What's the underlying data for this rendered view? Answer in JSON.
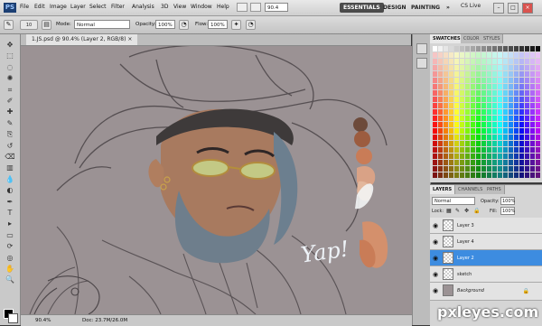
{
  "app": {
    "logo": "PS",
    "menu": [
      "File",
      "Edit",
      "Image",
      "Layer",
      "Select",
      "Filter",
      "Analysis",
      "3D",
      "View",
      "Window",
      "Help"
    ],
    "zoom_field": "90.4",
    "workspaces": [
      "ESSENTIALS",
      "DESIGN",
      "PAINTING"
    ],
    "workspace_more": "»",
    "cs_live": "CS Live",
    "window_buttons": [
      "–",
      "□",
      "×"
    ]
  },
  "options": {
    "mode_label": "Mode:",
    "mode_value": "Normal",
    "opacity_label": "Opacity:",
    "opacity_value": "100%",
    "flow_label": "Flow:",
    "flow_value": "100%",
    "brush_size": "10"
  },
  "tools": [
    "move-icon",
    "marquee-icon",
    "lasso-icon",
    "quick-select-icon",
    "crop-icon",
    "eyedropper-icon",
    "healing-icon",
    "brush-icon",
    "clone-icon",
    "history-brush-icon",
    "eraser-icon",
    "gradient-icon",
    "blur-icon",
    "dodge-icon",
    "pen-icon",
    "type-icon",
    "path-select-icon",
    "shape-icon",
    "3d-rotate-icon",
    "3d-orbit-icon",
    "hand-icon",
    "zoom-icon"
  ],
  "document": {
    "tab_title": "1.JS.psd @ 90.4% (Layer 2, RGB/8) ×",
    "zoom_status": "90.4%",
    "doc_status": "Doc: 23.7M/26.0M"
  },
  "swatches_panel": {
    "tabs": [
      "SWATCHES",
      "COLOR",
      "STYLES"
    ]
  },
  "layers_panel": {
    "tabs": [
      "LAYERS",
      "CHANNELS",
      "PATHS"
    ],
    "blend_mode": "Normal",
    "opacity_label": "Opacity:",
    "opacity_value": "100%",
    "lock_label": "Lock:",
    "fill_label": "Fill:",
    "fill_value": "100%",
    "layers": [
      {
        "name": "Layer 3",
        "selected": false
      },
      {
        "name": "Layer 4",
        "selected": false
      },
      {
        "name": "Layer 2",
        "selected": true
      },
      {
        "name": "sketch",
        "selected": false
      },
      {
        "name": "Background",
        "selected": false
      }
    ]
  },
  "canvas": {
    "handwritten_text": "Yap!"
  },
  "watermark": "pxleyes.com",
  "colors": {
    "canvas_bg": "#9b9294",
    "selected_layer": "#3d8ce0",
    "palette_swatches": [
      "#6d4a3a",
      "#9c5c3f",
      "#c97c57",
      "#d9a286",
      "#e3b79c",
      "#f2f4f4",
      "#e7e5e6"
    ]
  }
}
